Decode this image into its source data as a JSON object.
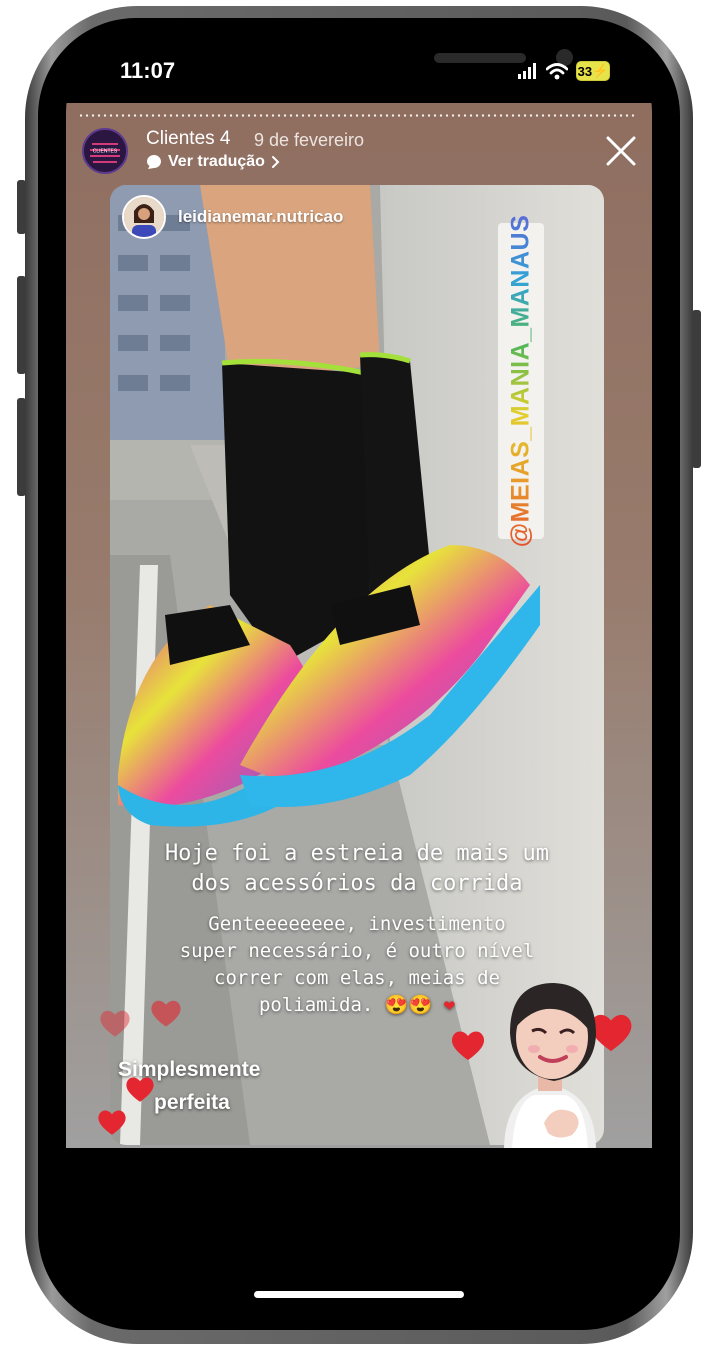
{
  "status_bar": {
    "time": "11:07",
    "battery": "33"
  },
  "story": {
    "author": "Clientes 4",
    "date": "9 de fevereiro",
    "translate_label": "Ver tradução",
    "avatar_text": "CLIENTES",
    "repost": {
      "handle": "leidianemar.nutricao",
      "mention": "@MEIAS_MANIA_MANAUS"
    },
    "caption_title_lines": [
      "Hoje foi a estreia de mais um",
      "dos acessórios da corrida"
    ],
    "caption_body_lines": [
      "Genteeeeeeee, investimento",
      "super necessário, é outro nível",
      "correr com elas, meias de",
      "poliamida. 😍😍"
    ],
    "overlay_lines": [
      "Simplesmente",
      "perfeita"
    ]
  },
  "icons": [
    "signal-icon",
    "wifi-icon",
    "battery-icon",
    "translate-icon",
    "chevron-right-icon",
    "close-icon",
    "heart-icon",
    "bitmoji-sticker"
  ],
  "colors": {
    "story_bg": "#8f6e60",
    "heart": "#e3262f",
    "battery": "#e7e34a"
  }
}
